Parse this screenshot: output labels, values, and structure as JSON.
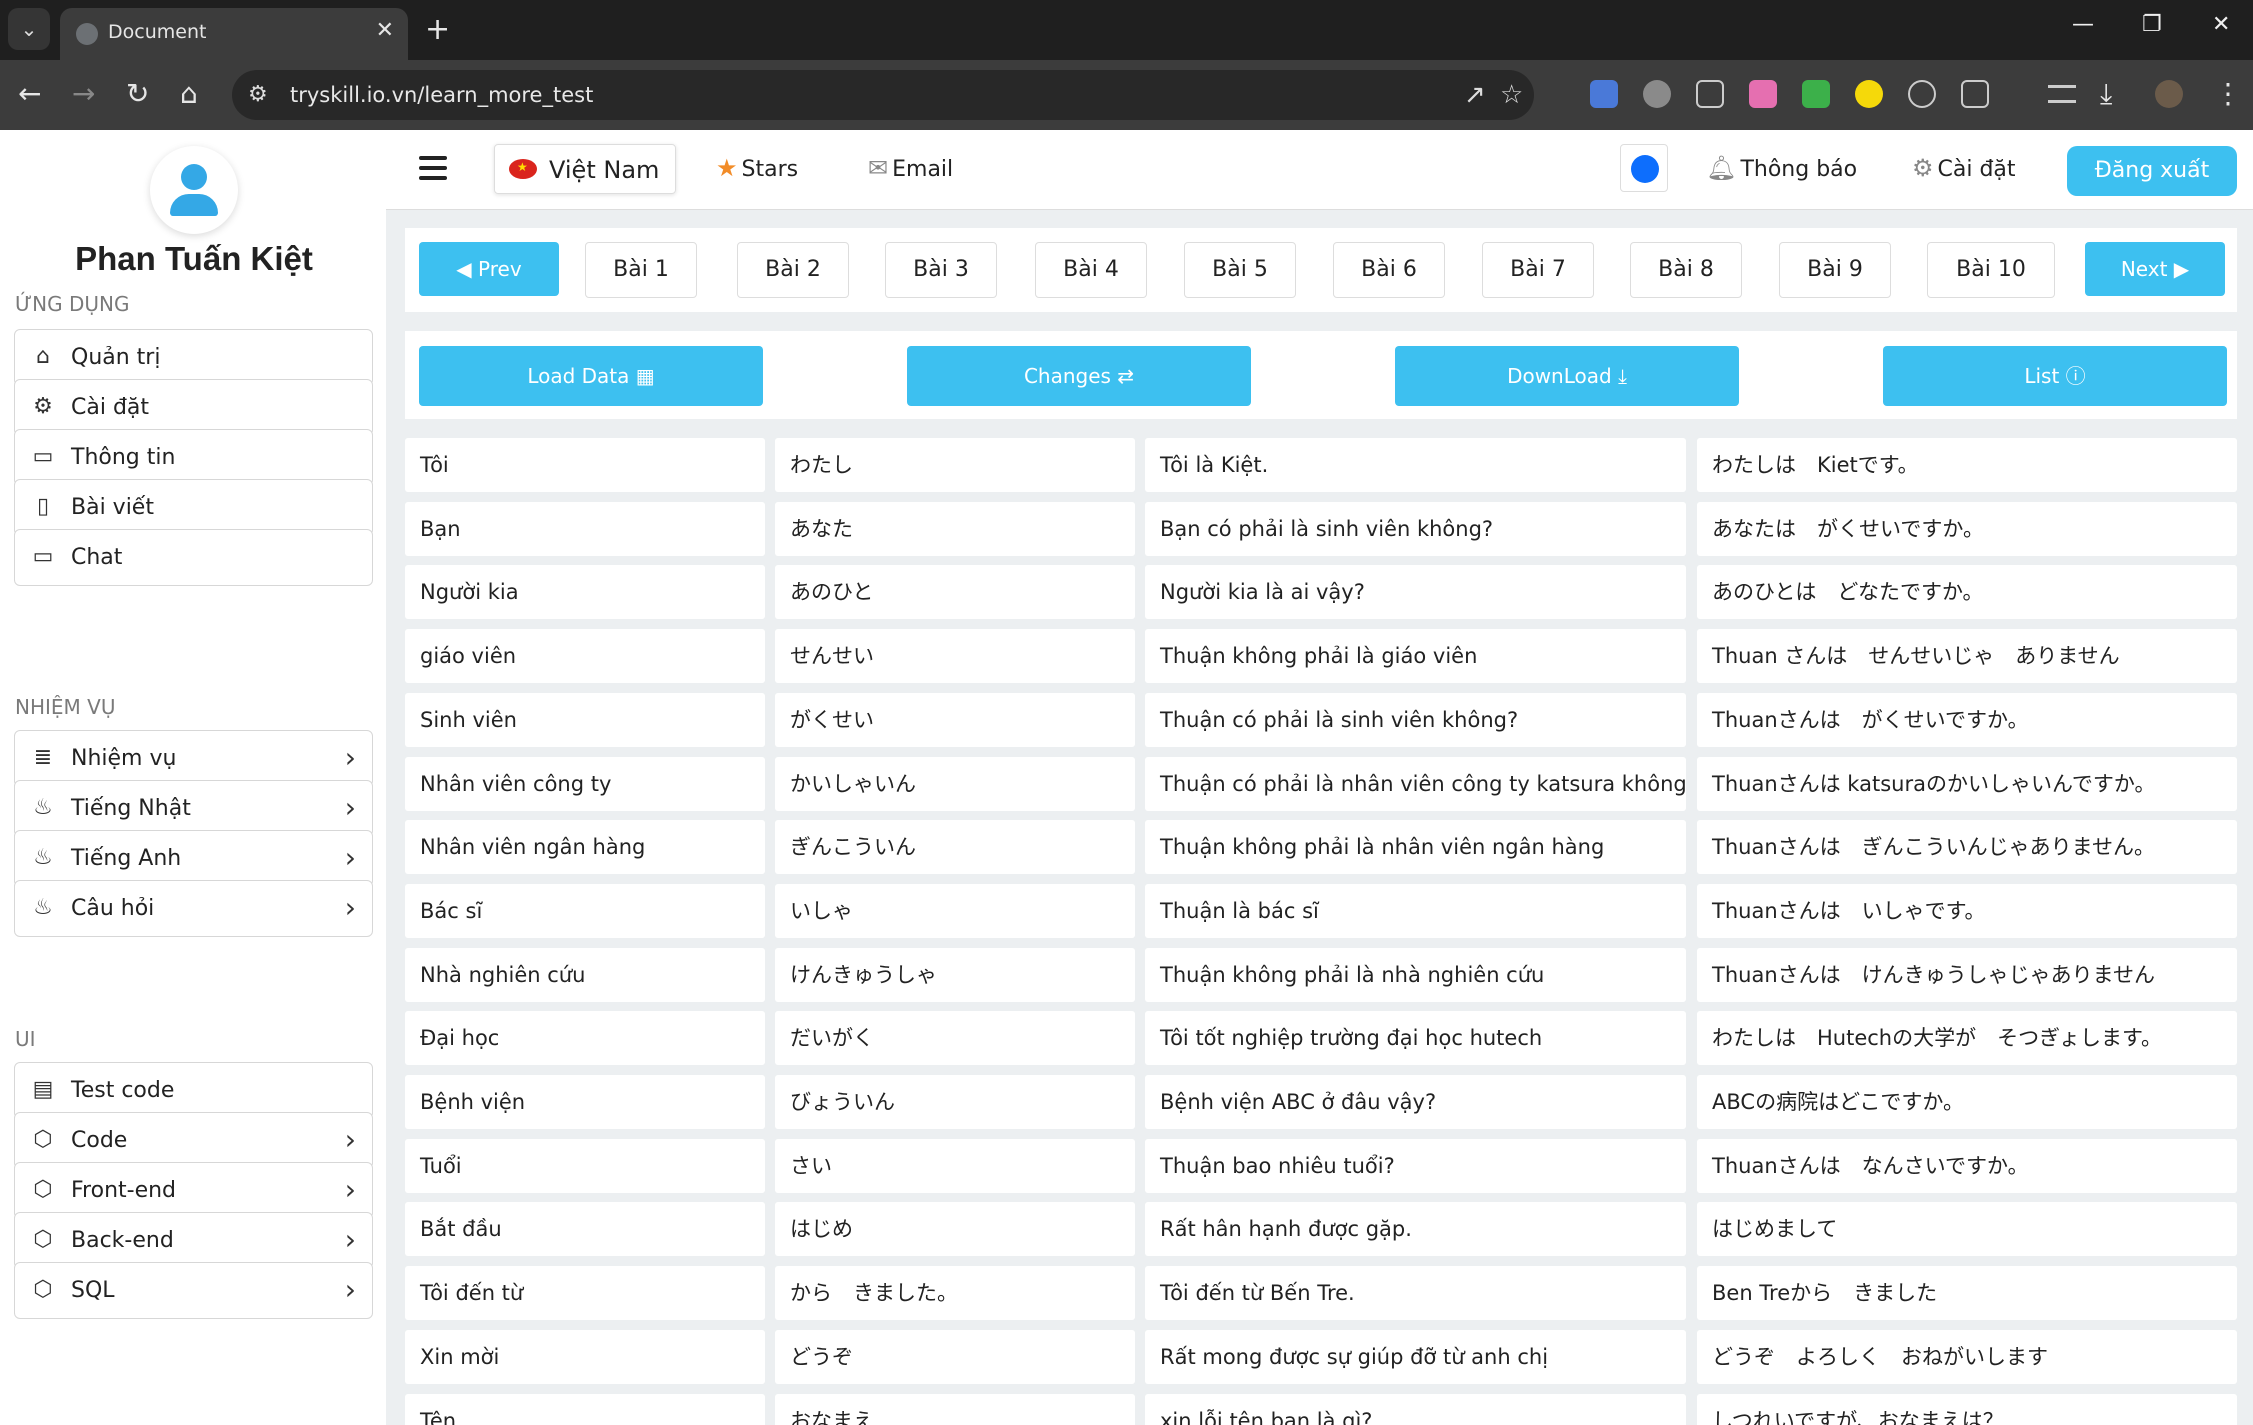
{
  "browser": {
    "tab_title": "Document",
    "url": "tryskill.io.vn/learn_more_test"
  },
  "sidebar": {
    "user_name": "Phan Tuấn Kiệt",
    "sections": [
      {
        "label": "ỨNG DỤNG",
        "items": [
          {
            "label": "Quản trị",
            "icon": "home-icon",
            "chevron": false
          },
          {
            "label": "Cài đặt",
            "icon": "gear-icon",
            "chevron": false
          },
          {
            "label": "Thông tin",
            "icon": "message-square-icon",
            "chevron": false
          },
          {
            "label": "Bài viết",
            "icon": "file-icon",
            "chevron": false
          },
          {
            "label": "Chat",
            "icon": "chat-icon",
            "chevron": false
          }
        ]
      },
      {
        "label": "NHIỆM VỤ",
        "items": [
          {
            "label": "Nhiệm vụ",
            "icon": "layers-icon",
            "chevron": true
          },
          {
            "label": "Tiếng Nhật",
            "icon": "fire-icon",
            "chevron": true
          },
          {
            "label": "Tiếng Anh",
            "icon": "fire-icon",
            "chevron": true
          },
          {
            "label": "Câu hỏi",
            "icon": "fire-icon",
            "chevron": true
          }
        ]
      },
      {
        "label": "UI",
        "items": [
          {
            "label": "Test code",
            "icon": "inbox-icon",
            "chevron": false
          },
          {
            "label": "Code",
            "icon": "codepen-icon",
            "chevron": true
          },
          {
            "label": "Front-end",
            "icon": "codepen-icon",
            "chevron": true
          },
          {
            "label": "Back-end",
            "icon": "codepen-icon",
            "chevron": true
          },
          {
            "label": "SQL",
            "icon": "codepen-icon",
            "chevron": true
          }
        ]
      }
    ]
  },
  "topnav": {
    "language": "Việt Nam",
    "stars": "Stars",
    "email": "Email",
    "notifications": "Thông báo",
    "settings": "Cài đặt",
    "logout": "Đăng xuất",
    "theme_color": "#0d6efd"
  },
  "lessons": {
    "prev": "Prev",
    "next": "Next",
    "items": [
      "Bài 1",
      "Bài 2",
      "Bài 3",
      "Bài 4",
      "Bài 5",
      "Bài 6",
      "Bài 7",
      "Bài 8",
      "Bài 9",
      "Bài 10"
    ]
  },
  "actions": {
    "load_data": "Load Data",
    "changes": "Changes",
    "download": "DownLoad",
    "list": "List"
  },
  "vocab_rows": [
    [
      "Tôi",
      "わたし",
      "Tôi là Kiệt.",
      "わたしは　Kietです。"
    ],
    [
      "Bạn",
      "あなた",
      "Bạn có phải là sinh viên không?",
      "あなたは　がくせいですか。"
    ],
    [
      "Người kia",
      "あのひと",
      "Người kia là ai vậy?",
      "あのひとは　どなたですか。"
    ],
    [
      "giáo viên",
      "せんせい",
      "Thuận không phải là giáo viên",
      "Thuan さんは　せんせいじゃ　ありません"
    ],
    [
      "Sinh viên",
      "がくせい",
      "Thuận có phải là sinh viên không?",
      "Thuanさんは　がくせいですか。"
    ],
    [
      "Nhân viên công ty",
      "かいしゃいん",
      "Thuận có phải là nhân viên công ty katsura không",
      "Thuanさんは katsuraのかいしゃいんですか。"
    ],
    [
      "Nhân viên ngân hàng",
      "ぎんこういん",
      "Thuận không phải là nhân viên ngân hàng",
      "Thuanさんは　ぎんこういんじゃありません。"
    ],
    [
      "Bác sĩ",
      "いしゃ",
      "Thuận là bác sĩ",
      "Thuanさんは　いしゃです。"
    ],
    [
      "Nhà nghiên cứu",
      "けんきゅうしゃ",
      "Thuận không phải là nhà nghiên cứu",
      "Thuanさんは　けんきゅうしゃじゃありません"
    ],
    [
      "Đại học",
      "だいがく",
      "Tôi tốt nghiệp trường đại học hutech",
      "わたしは　Hutechの大学が　そつぎょします。"
    ],
    [
      "Bệnh viện",
      "びょういん",
      "Bệnh viện ABC ở đâu vậy?",
      "ABCの病院はどこですか。"
    ],
    [
      "Tuổi",
      "さい",
      "Thuận bao nhiêu tuổi?",
      "Thuanさんは　なんさいですか。"
    ],
    [
      "Bắt đầu",
      "はじめ",
      "Rất hân hạnh được gặp.",
      "はじめまして"
    ],
    [
      "Tôi đến từ",
      "から　きました。",
      "Tôi đến từ Bến Tre.",
      "Ben Treから　きました"
    ],
    [
      "Xin mời",
      "どうぞ",
      "Rất mong được sự giúp đỡ từ anh chị",
      "どうぞ　よろしく　おねがいします"
    ],
    [
      "Tên",
      "おなまえ",
      "xin lỗi tên bạn là gì?",
      "しつれいですが、おなまえは？"
    ]
  ]
}
